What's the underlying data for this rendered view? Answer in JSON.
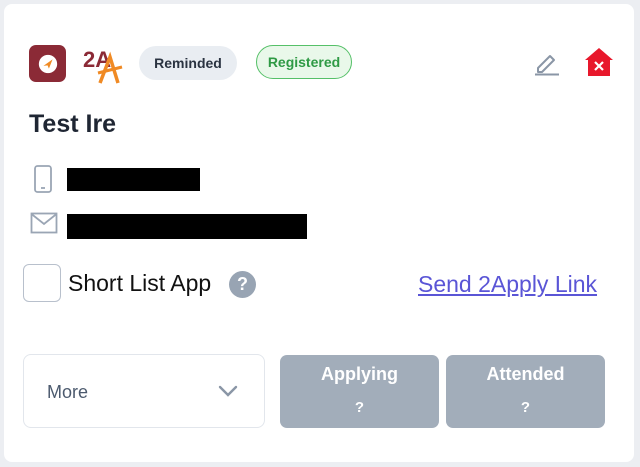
{
  "header": {
    "app_icon": "paper-plane-icon",
    "brand_logo_text": "2A",
    "status_badges": [
      {
        "label": "Reminded",
        "color": "#e9edf2"
      },
      {
        "label": "Registered",
        "color": "#2f9a45"
      }
    ],
    "edit_icon": "pencil-icon",
    "remove_icon": "house-x-icon",
    "remove_color": "#e8182c"
  },
  "contact": {
    "name": "Test Ire",
    "phone_icon": "phone-icon",
    "email_icon": "envelope-icon"
  },
  "shortlist": {
    "label": "Short List App",
    "help": "?",
    "checked": false
  },
  "send_link": {
    "label": "Send 2Apply Link",
    "color": "#5a55d6"
  },
  "more": {
    "label": "More"
  },
  "stats": [
    {
      "title": "Applying",
      "value": "?"
    },
    {
      "title": "Attended",
      "value": "?"
    }
  ]
}
